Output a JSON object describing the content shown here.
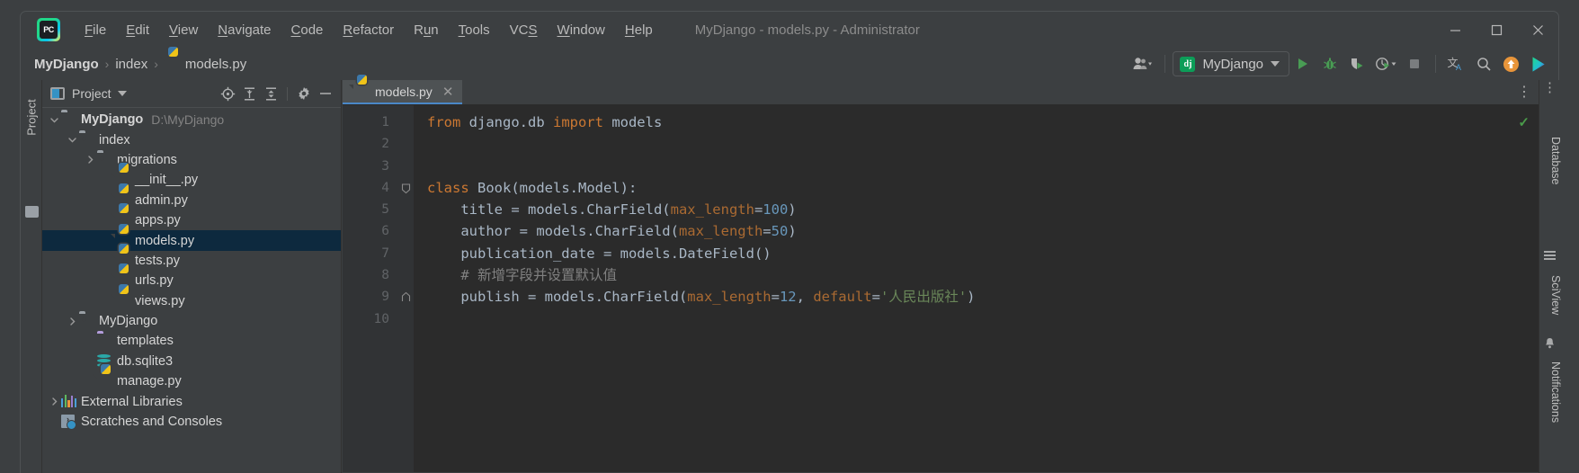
{
  "window": {
    "title": "MyDjango - models.py - Administrator",
    "logo_text": "PC",
    "minimize": "—",
    "maximize": "□",
    "close": "✕"
  },
  "menubar": {
    "items": [
      {
        "label": "File",
        "mnemonic": "F"
      },
      {
        "label": "Edit",
        "mnemonic": "E"
      },
      {
        "label": "View",
        "mnemonic": "V"
      },
      {
        "label": "Navigate",
        "mnemonic": "N"
      },
      {
        "label": "Code",
        "mnemonic": "C"
      },
      {
        "label": "Refactor",
        "mnemonic": "R"
      },
      {
        "label": "Run",
        "mnemonic": "u"
      },
      {
        "label": "Tools",
        "mnemonic": "T"
      },
      {
        "label": "VCS",
        "mnemonic": "S"
      },
      {
        "label": "Window",
        "mnemonic": "W"
      },
      {
        "label": "Help",
        "mnemonic": "H"
      }
    ]
  },
  "breadcrumb": {
    "separator": "›",
    "items": [
      "MyDjango",
      "index",
      "models.py"
    ]
  },
  "toolbar": {
    "collaborate_icon": "user-group-icon",
    "run_config": {
      "icon_text": "dj",
      "label": "MyDjango"
    },
    "actions": [
      {
        "name": "run-button",
        "glyph": "▶"
      },
      {
        "name": "debug-button",
        "glyph": "bug"
      },
      {
        "name": "run-coverage-button",
        "glyph": "shield"
      },
      {
        "name": "profile-button",
        "glyph": "gauge"
      }
    ],
    "right_icons": [
      {
        "name": "translate-icon",
        "label": "文A"
      },
      {
        "name": "search-everywhere-icon",
        "label": "search"
      },
      {
        "name": "update-available-icon",
        "label": "update"
      },
      {
        "name": "ide-services-icon",
        "label": "services"
      }
    ]
  },
  "left_strip": {
    "project_tab": "Project",
    "structure_icon": "structure-icon"
  },
  "project_panel": {
    "title": "Project",
    "header_icons": [
      {
        "name": "select-opened-file-icon"
      },
      {
        "name": "expand-all-icon"
      },
      {
        "name": "collapse-all-icon"
      },
      {
        "name": "settings-gear-icon"
      },
      {
        "name": "hide-panel-icon"
      }
    ],
    "tree": [
      {
        "label": "MyDjango",
        "path": "D:\\MyDjango",
        "indent": 0,
        "chevron": "down",
        "icon": "folder",
        "bold": true,
        "selected": false
      },
      {
        "label": "index",
        "path": "",
        "indent": 1,
        "chevron": "down",
        "icon": "folder-source",
        "bold": false,
        "selected": false
      },
      {
        "label": "migrations",
        "path": "",
        "indent": 2,
        "chevron": "right",
        "icon": "folder-source",
        "bold": false,
        "selected": false
      },
      {
        "label": "__init__.py",
        "path": "",
        "indent": 3,
        "chevron": "none",
        "icon": "python-file",
        "bold": false,
        "selected": false
      },
      {
        "label": "admin.py",
        "path": "",
        "indent": 3,
        "chevron": "none",
        "icon": "python-file",
        "bold": false,
        "selected": false
      },
      {
        "label": "apps.py",
        "path": "",
        "indent": 3,
        "chevron": "none",
        "icon": "python-file",
        "bold": false,
        "selected": false
      },
      {
        "label": "models.py",
        "path": "",
        "indent": 3,
        "chevron": "none",
        "icon": "python-file",
        "bold": false,
        "selected": true
      },
      {
        "label": "tests.py",
        "path": "",
        "indent": 3,
        "chevron": "none",
        "icon": "python-file",
        "bold": false,
        "selected": false
      },
      {
        "label": "urls.py",
        "path": "",
        "indent": 3,
        "chevron": "none",
        "icon": "python-file",
        "bold": false,
        "selected": false
      },
      {
        "label": "views.py",
        "path": "",
        "indent": 3,
        "chevron": "none",
        "icon": "python-file",
        "bold": false,
        "selected": false
      },
      {
        "label": "MyDjango",
        "path": "",
        "indent": 1,
        "chevron": "right",
        "icon": "folder-source",
        "bold": false,
        "selected": false
      },
      {
        "label": "templates",
        "path": "",
        "indent": 2,
        "chevron": "none",
        "icon": "folder-template",
        "bold": false,
        "selected": false
      },
      {
        "label": "db.sqlite3",
        "path": "",
        "indent": 2,
        "chevron": "none",
        "icon": "database-file",
        "bold": false,
        "selected": false
      },
      {
        "label": "manage.py",
        "path": "",
        "indent": 2,
        "chevron": "none",
        "icon": "python-file",
        "bold": false,
        "selected": false
      },
      {
        "label": "External Libraries",
        "path": "",
        "indent": 0,
        "chevron": "right",
        "icon": "libraries",
        "bold": false,
        "selected": false
      },
      {
        "label": "Scratches and Consoles",
        "path": "",
        "indent": 0,
        "chevron": "none",
        "icon": "scratches",
        "bold": false,
        "selected": false
      }
    ]
  },
  "editor": {
    "tab": {
      "label": "models.py",
      "icon": "python-file-icon",
      "close": "✕"
    },
    "options_icon": "more-options-icon",
    "inspection_status": "✓",
    "gutter_lines": [
      "1",
      "2",
      "3",
      "4",
      "5",
      "6",
      "7",
      "8",
      "9",
      "10"
    ],
    "code_lines": [
      {
        "n": 1,
        "fold": "none",
        "tokens": [
          {
            "t": "from",
            "c": "kw"
          },
          {
            "t": " django.db ",
            "c": "fn"
          },
          {
            "t": "import",
            "c": "kw"
          },
          {
            "t": " models",
            "c": "fn"
          }
        ]
      },
      {
        "n": 2,
        "fold": "none",
        "tokens": []
      },
      {
        "n": 3,
        "fold": "none",
        "tokens": []
      },
      {
        "n": 4,
        "fold": "start",
        "tokens": [
          {
            "t": "class",
            "c": "kw"
          },
          {
            "t": " Book(models.Model):",
            "c": "fn"
          }
        ]
      },
      {
        "n": 5,
        "fold": "none",
        "tokens": [
          {
            "t": "    title = models.CharField(",
            "c": "fn"
          },
          {
            "t": "max_length",
            "c": "arg"
          },
          {
            "t": "=",
            "c": "fn"
          },
          {
            "t": "100",
            "c": "num"
          },
          {
            "t": ")",
            "c": "fn"
          }
        ]
      },
      {
        "n": 6,
        "fold": "none",
        "tokens": [
          {
            "t": "    author = models.CharField(",
            "c": "fn"
          },
          {
            "t": "max_length",
            "c": "arg"
          },
          {
            "t": "=",
            "c": "fn"
          },
          {
            "t": "50",
            "c": "num"
          },
          {
            "t": ")",
            "c": "fn"
          }
        ]
      },
      {
        "n": 7,
        "fold": "none",
        "tokens": [
          {
            "t": "    publication_date = models.DateField()",
            "c": "fn"
          }
        ]
      },
      {
        "n": 8,
        "fold": "none",
        "tokens": [
          {
            "t": "    # 新增字段并设置默认值",
            "c": "cmt"
          }
        ]
      },
      {
        "n": 9,
        "fold": "end",
        "tokens": [
          {
            "t": "    publish = models.CharField(",
            "c": "fn"
          },
          {
            "t": "max_length",
            "c": "arg"
          },
          {
            "t": "=",
            "c": "fn"
          },
          {
            "t": "12",
            "c": "num"
          },
          {
            "t": ", ",
            "c": "fn"
          },
          {
            "t": "default",
            "c": "arg"
          },
          {
            "t": "=",
            "c": "fn"
          },
          {
            "t": "'人民出版社'",
            "c": "str"
          },
          {
            "t": ")",
            "c": "fn"
          }
        ]
      },
      {
        "n": 10,
        "fold": "none",
        "tokens": []
      }
    ]
  },
  "right_strip": {
    "tabs": [
      {
        "label": "Database",
        "name": "database-tool-tab"
      },
      {
        "label": "SciView",
        "name": "sciview-tool-tab"
      },
      {
        "label": "Notifications",
        "name": "notifications-tool-tab"
      }
    ]
  },
  "colors": {
    "background": "#3c3f41",
    "editor_bg": "#2b2b2b",
    "selection": "#0d293e",
    "accent": "#4a88c7",
    "keyword": "#cc7832",
    "string": "#6a8759",
    "number": "#6897bb",
    "named_arg": "#aa6a32",
    "comment": "#808080",
    "default_text": "#a9b7c6",
    "run_green": "#499c54"
  }
}
